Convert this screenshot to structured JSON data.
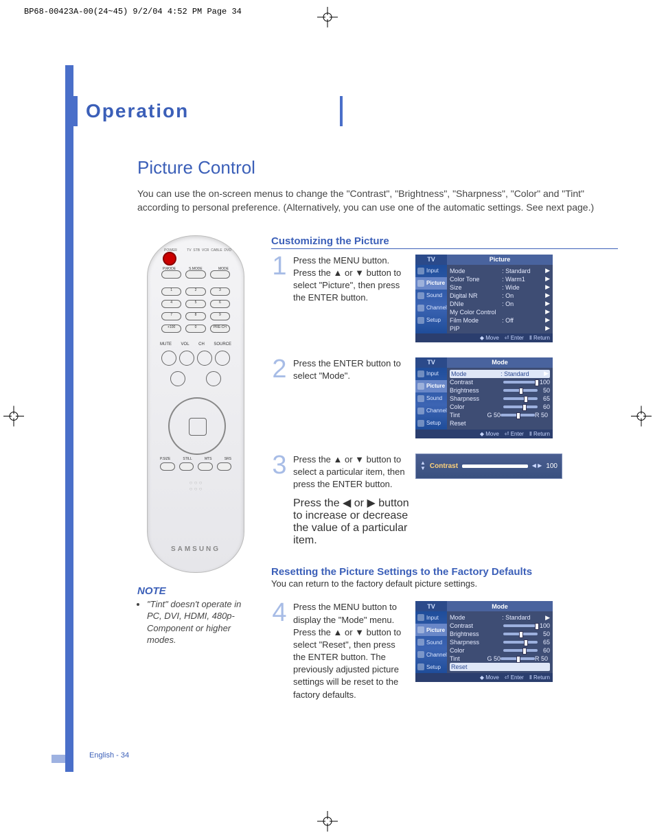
{
  "print_info": "BP68-00423A-00(24~45)  9/2/04  4:52 PM  Page 34",
  "section_title": "Operation",
  "page_title": "Picture Control",
  "intro": "You can use the on-screen menus to change the \"Contrast\", \"Brightness\", \"Sharpness\", \"Color\" and \"Tint\" according to personal preference. (Alternatively, you can use one of the automatic settings. See next page.)",
  "remote": {
    "brand": "SAMSUNG"
  },
  "note": {
    "title": "NOTE",
    "text": "\"Tint\" doesn't operate in PC, DVI, HDMI, 480p-Component or higher modes."
  },
  "subsections": {
    "custom": "Customizing the Picture",
    "reset_title": "Resetting the Picture Settings to the Factory Defaults",
    "reset_intro": "You can return to the factory default picture settings."
  },
  "steps": {
    "s1": {
      "num": "1",
      "text": "Press the MENU button. Press the ▲ or ▼ button to select \"Picture\", then press the ENTER button."
    },
    "s2": {
      "num": "2",
      "text": "Press the ENTER button to select \"Mode\"."
    },
    "s3": {
      "num": "3",
      "text": "Press the ▲ or ▼ button to select a particular item, then press the ENTER button.",
      "text2": "Press the ◀ or ▶ button to increase or decrease the value of a particular item."
    },
    "s4": {
      "num": "4",
      "text": "Press the MENU button to display the \"Mode\" menu. Press the ▲ or ▼ button to select \"Reset\", then press the ENTER button. The previously adjusted picture settings will be reset to the factory defaults."
    }
  },
  "osd": {
    "tv_label": "TV",
    "tabs": {
      "input": "Input",
      "picture": "Picture",
      "sound": "Sound",
      "channel": "Channel",
      "setup": "Setup"
    },
    "footer": {
      "move": "Move",
      "enter": "Enter",
      "return": "Return"
    },
    "panel1": {
      "title": "Picture",
      "rows": [
        {
          "k": "Mode",
          "v": ": Standard"
        },
        {
          "k": "Color Tone",
          "v": ": Warm1"
        },
        {
          "k": "Size",
          "v": ": Wide"
        },
        {
          "k": "Digital NR",
          "v": ": On"
        },
        {
          "k": "DNIe",
          "v": ": On"
        },
        {
          "k": "My Color Control",
          "v": ""
        },
        {
          "k": "Film Mode",
          "v": ": Off"
        },
        {
          "k": "PIP",
          "v": ""
        }
      ]
    },
    "panel2": {
      "title": "Mode",
      "rows": [
        {
          "k": "Mode",
          "v": ": Standard",
          "sel": true,
          "arrow": true
        },
        {
          "k": "Contrast",
          "v": "100",
          "bar": 100
        },
        {
          "k": "Brightness",
          "v": "50",
          "bar": 50
        },
        {
          "k": "Sharpness",
          "v": "65",
          "bar": 65
        },
        {
          "k": "Color",
          "v": "60",
          "bar": 60
        },
        {
          "k": "Tint",
          "vL": "G 50",
          "vR": "R 50",
          "bar": 50
        },
        {
          "k": "Reset",
          "v": ""
        }
      ]
    },
    "panel3": {
      "label": "Contrast",
      "value": "100",
      "pct": 100
    },
    "panel4": {
      "title": "Mode",
      "rows": [
        {
          "k": "Mode",
          "v": ": Standard",
          "arrow": true
        },
        {
          "k": "Contrast",
          "v": "100",
          "bar": 100
        },
        {
          "k": "Brightness",
          "v": "50",
          "bar": 50
        },
        {
          "k": "Sharpness",
          "v": "65",
          "bar": 65
        },
        {
          "k": "Color",
          "v": "60",
          "bar": 60
        },
        {
          "k": "Tint",
          "vL": "G 50",
          "vR": "R 50",
          "bar": 50
        },
        {
          "k": "Reset",
          "v": "",
          "sel": true
        }
      ]
    }
  },
  "page_footer": "English - 34"
}
